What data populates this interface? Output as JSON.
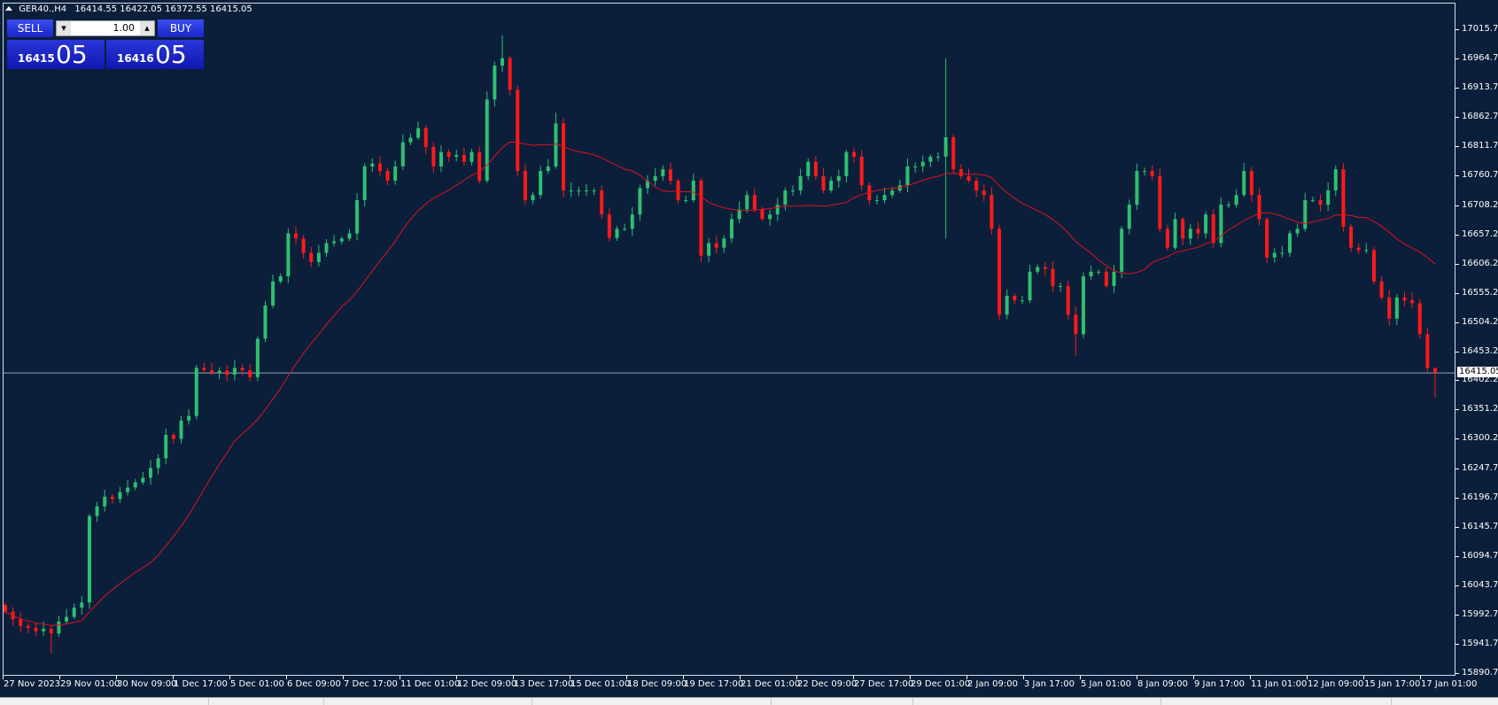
{
  "header": {
    "symbol": "GER40.,H4",
    "ohlc_text": "16414.55 16422.05 16372.55 16415.05"
  },
  "trade_panel": {
    "sell_label": "SELL",
    "buy_label": "BUY",
    "lot": "1.00",
    "sell_price_small": "16415",
    "sell_price_big": "05",
    "buy_price_small": "16416",
    "buy_price_big": "05"
  },
  "colors": {
    "background": "#0b1f3a",
    "bull": "#2fbf71",
    "bear": "#ff1a1a",
    "ma": "#e01020",
    "price_line": "#8fa6b8"
  },
  "chart_data": {
    "type": "candlestick",
    "title": "GER40.,H4",
    "current_price": "16415.05",
    "ylim": [
      15890.7,
      17015.7
    ],
    "y_ticks": [
      "17015.70",
      "16964.70",
      "16913.70",
      "16862.70",
      "16811.70",
      "16760.70",
      "16708.20",
      "16657.20",
      "16606.20",
      "16555.20",
      "16504.20",
      "16453.20",
      "16402.20",
      "16351.20",
      "16300.20",
      "16247.70",
      "16196.70",
      "16145.70",
      "16094.70",
      "16043.70",
      "15992.70",
      "15941.70",
      "15890.70"
    ],
    "x_ticks": [
      "27 Nov 2023",
      "29 Nov 01:00",
      "30 Nov 09:00",
      "1 Dec 17:00",
      "5 Dec 01:00",
      "6 Dec 09:00",
      "7 Dec 17:00",
      "11 Dec 01:00",
      "12 Dec 09:00",
      "13 Dec 17:00",
      "15 Dec 01:00",
      "18 Dec 09:00",
      "19 Dec 17:00",
      "21 Dec 01:00",
      "22 Dec 09:00",
      "27 Dec 17:00",
      "29 Dec 01:00",
      "2 Jan 09:00",
      "3 Jan 17:00",
      "5 Jan 01:00",
      "8 Jan 09:00",
      "9 Jan 17:00",
      "11 Jan 01:00",
      "12 Jan 09:00",
      "15 Jan 17:00",
      "17 Jan 01:00"
    ],
    "first_open": 16010,
    "closes": [
      15998,
      15985,
      15973,
      15970,
      15964,
      15968,
      15960,
      15981,
      15989,
      16005,
      16014,
      16165,
      16182,
      16199,
      16195,
      16207,
      16215,
      16224,
      16232,
      16249,
      16266,
      16307,
      16300,
      16332,
      16340,
      16424,
      16420,
      16416,
      16419,
      16412,
      16424,
      16420,
      16408,
      16475,
      16533,
      16575,
      16584,
      16659,
      16650,
      16625,
      16609,
      16625,
      16642,
      16645,
      16650,
      16659,
      16717,
      16776,
      16781,
      16768,
      16751,
      16776,
      16818,
      16826,
      16843,
      16810,
      16776,
      16801,
      16793,
      16796,
      16784,
      16801,
      16751,
      16893,
      16952,
      16965,
      16910,
      16768,
      16717,
      16726,
      16768,
      16776,
      16851,
      16734,
      16734,
      16734,
      16734,
      16734,
      16692,
      16651,
      16667,
      16667,
      16692,
      16738,
      16751,
      16759,
      16771,
      16751,
      16717,
      16717,
      16751,
      16620,
      16642,
      16634,
      16650,
      16684,
      16701,
      16726,
      16701,
      16684,
      16692,
      16709,
      16734,
      16734,
      16759,
      16784,
      16759,
      16734,
      16751,
      16759,
      16801,
      16793,
      16743,
      16717,
      16717,
      16726,
      16734,
      16743,
      16776,
      16776,
      16784,
      16793,
      16793,
      16827,
      16771,
      16759,
      16751,
      16734,
      16726,
      16667,
      16517,
      16550,
      16542,
      16542,
      16592,
      16600,
      16597,
      16567,
      16567,
      16517,
      16483,
      16584,
      16592,
      16592,
      16567,
      16592,
      16667,
      16709,
      16768,
      16768,
      16759,
      16667,
      16634,
      16684,
      16650,
      16667,
      16659,
      16692,
      16642,
      16709,
      16709,
      16726,
      16768,
      16726,
      16684,
      16617,
      16625,
      16625,
      16659,
      16667,
      16717,
      16717,
      16709,
      16734,
      16771,
      16671,
      16634,
      16630,
      16630,
      16575,
      16547,
      16510,
      16547,
      16542,
      16537,
      16483,
      16424,
      16415.05
    ],
    "notable_highs": {
      "65": 17005,
      "123": 16965,
      "72": 16870,
      "123b": 16965,
      "187": 16422.05
    },
    "notable_lows": {
      "6": 15925,
      "140": 16445,
      "123": 16650,
      "187": 16372.55
    },
    "ma_period": 20
  }
}
